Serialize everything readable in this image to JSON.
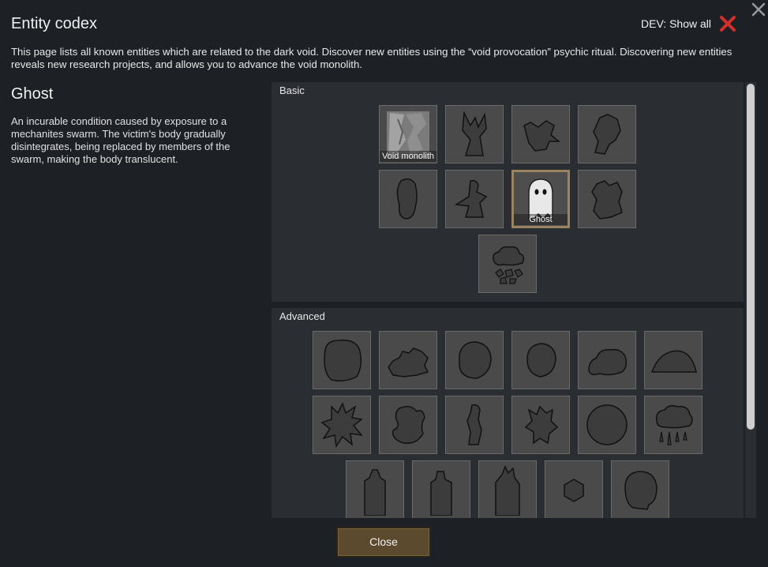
{
  "window": {
    "title": "Entity codex",
    "close_icon": "close-x-icon",
    "dev_toggle": {
      "label": "DEV: Show all",
      "state_icon": "red-cross-icon",
      "state_color": "#d62d2d"
    },
    "description": "This page lists all known entities which are related to the dark void. Discover new entities using the “void provocation” psychic ritual. Discovering new entities reveals new research projects, and allows you to advance the void monolith."
  },
  "selected_entity": {
    "name": "Ghost",
    "description": "An incurable condition caused by exposure to a mechanites swarm. The victim's body gradually disintegrates, being replaced by members of the swarm, making the body translucent."
  },
  "sections": {
    "basic": {
      "label": "Basic",
      "tiles": [
        {
          "label": "Void monolith",
          "icon": "void-monolith-icon"
        },
        {
          "label": "",
          "icon": "twisted-tree-silhouette-icon"
        },
        {
          "label": "",
          "icon": "creature-silhouette-icon"
        },
        {
          "label": "",
          "icon": "blob-silhouette-icon"
        },
        {
          "label": "",
          "icon": "head-silhouette-icon"
        },
        {
          "label": "",
          "icon": "beaked-figure-silhouette-icon"
        },
        {
          "label": "Ghost",
          "icon": "ghost-icon",
          "selected": true
        },
        {
          "label": "",
          "icon": "beast-silhouette-icon"
        },
        {
          "label": "",
          "icon": "cloud-rubble-icon"
        }
      ]
    },
    "advanced": {
      "label": "Advanced",
      "tiles": [
        {
          "icon": "round-mass-silhouette-icon"
        },
        {
          "icon": "spiky-creature-silhouette-icon"
        },
        {
          "icon": "round-blob-silhouette-icon"
        },
        {
          "icon": "small-blob-silhouette-icon"
        },
        {
          "icon": "flat-blob-silhouette-icon"
        },
        {
          "icon": "mound-silhouette-icon"
        },
        {
          "icon": "spiky-burst-silhouette-icon"
        },
        {
          "icon": "worm-silhouette-icon"
        },
        {
          "icon": "standing-figure-silhouette-icon"
        },
        {
          "icon": "jagged-creature-silhouette-icon"
        },
        {
          "icon": "circle-silhouette-icon"
        },
        {
          "icon": "dripping-cloud-icon"
        },
        {
          "icon": "tower-silhouette-icon"
        },
        {
          "icon": "tower-silhouette-icon"
        },
        {
          "icon": "tall-tower-silhouette-icon"
        },
        {
          "icon": "hexagon-icon"
        },
        {
          "icon": "head-blob-silhouette-icon"
        }
      ]
    }
  },
  "footer": {
    "close_label": "Close"
  },
  "colors": {
    "background": "#1d2126",
    "panel": "#2a2d31",
    "tile": "#4a4a4a",
    "selected_border": "#9a8360",
    "button": "#5b4a2e"
  }
}
